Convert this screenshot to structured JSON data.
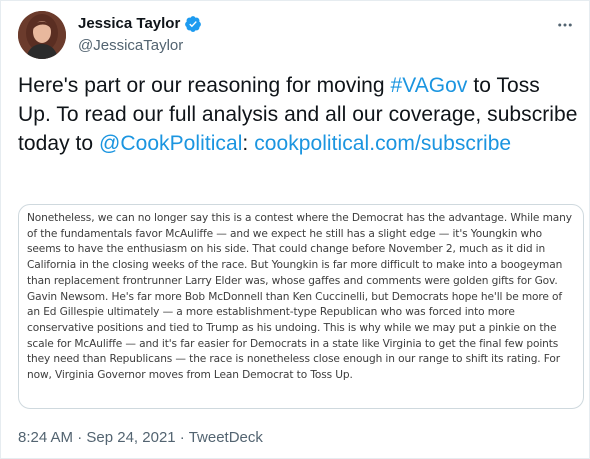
{
  "author": {
    "display_name": "Jessica Taylor",
    "handle": "@JessicaTaylor",
    "verified": true,
    "avatar_icon": "person-avatar"
  },
  "menu": {
    "more_icon": "more-horizontal-icon"
  },
  "tweet": {
    "text_part1": "Here's part or our reasoning for moving ",
    "hashtag": "#VAGov",
    "text_part2": " to Toss Up. To read our full analysis and all our coverage, subscribe today to ",
    "mention": "@CookPolitical",
    "text_part3": ": ",
    "link": "cookpolitical.com/subscribe"
  },
  "media": {
    "excerpt": "Nonetheless, we can no longer say this is a contest where the Democrat has the advantage. While many of the fundamentals favor McAuliffe — and we expect he still has a slight edge — it's Youngkin who seems to have the enthusiasm on his side. That could change before November 2, much as it did in California in the closing weeks of the race. But Youngkin is far more difficult to make into a boogeyman than replacement frontrunner Larry Elder was, whose gaffes and comments were golden gifts for Gov. Gavin Newsom. He's far more Bob McDonnell than Ken Cuccinelli, but Democrats hope he'll be more of an Ed Gillespie ultimately — a more establishment-type Republican who was forced into more conservative positions and tied to Trump as his undoing. This is why while we may put a pinkie on the scale for McAuliffe — and it's far easier for Democrats in a state like Virginia to get the final few points they need than Republicans — the race is nonetheless close enough in our range to shift its rating. For now, Virginia Governor moves from Lean Democrat to Toss Up."
  },
  "meta": {
    "time": "8:24 AM",
    "separator1": " · ",
    "date": "Sep 24, 2021",
    "separator2": " · ",
    "source": "TweetDeck"
  },
  "colors": {
    "link": "#1b95e0",
    "verified": "#1d9bf0",
    "secondary_text": "#536471"
  }
}
